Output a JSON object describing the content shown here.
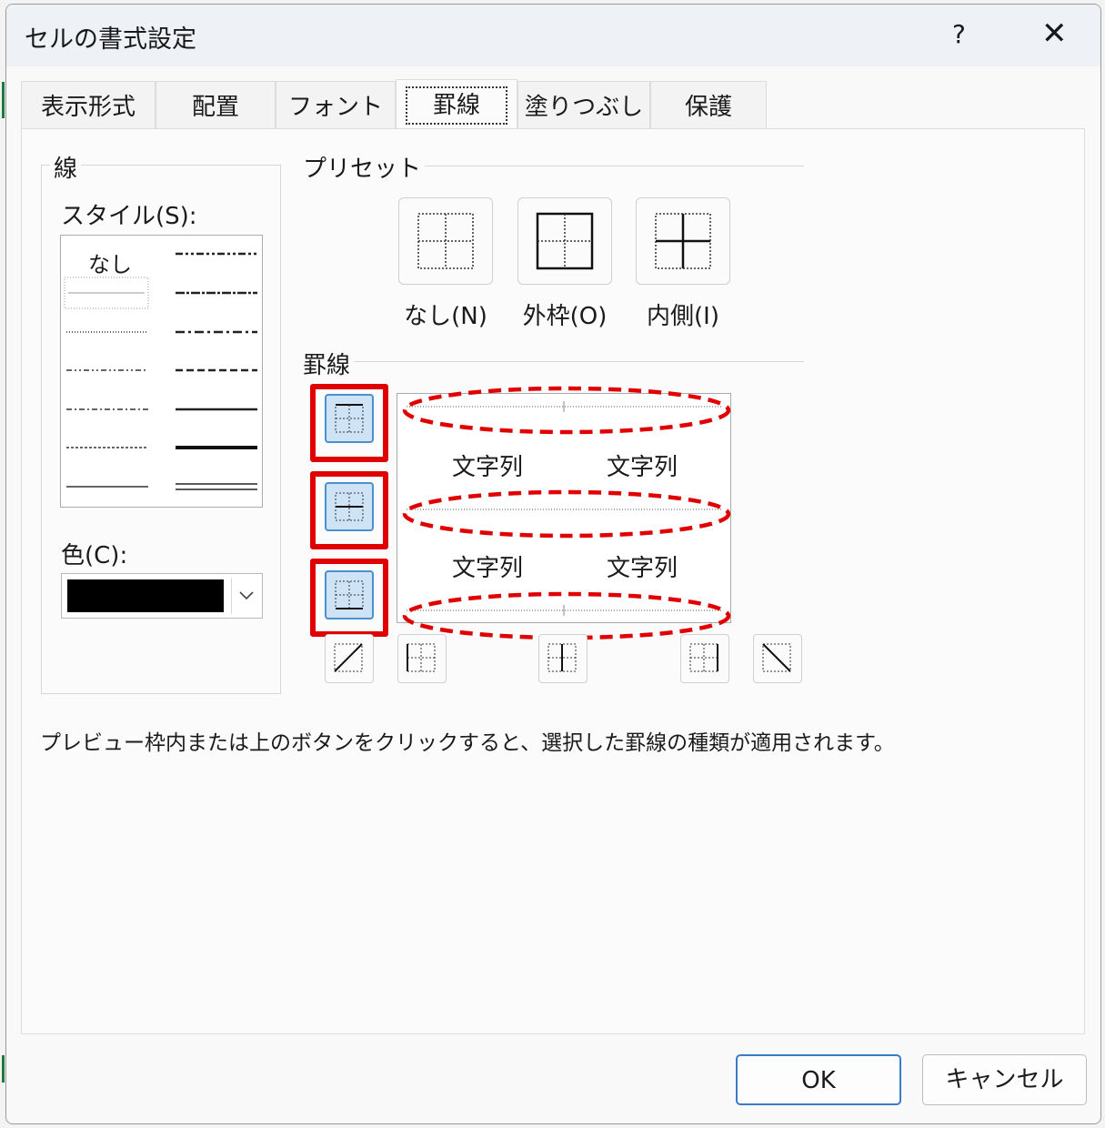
{
  "window": {
    "title": "セルの書式設定",
    "help_label": "?",
    "close_label": "✕"
  },
  "tabs": [
    {
      "label": "表示形式"
    },
    {
      "label": "配置"
    },
    {
      "label": "フォント"
    },
    {
      "label": "罫線",
      "active": true
    },
    {
      "label": "塗りつぶし"
    },
    {
      "label": "保護"
    }
  ],
  "line_group": {
    "label": "線",
    "style_label": "スタイル(S):",
    "style_none": "なし",
    "color_label": "色(C):",
    "color_value": "#000000"
  },
  "presets": {
    "label": "プリセット",
    "items": [
      {
        "label": "なし(N)"
      },
      {
        "label": "外枠(O)"
      },
      {
        "label": "内側(I)"
      }
    ]
  },
  "border_group": {
    "label": "罫線",
    "preview_texts": [
      "文字列",
      "文字列",
      "文字列",
      "文字列"
    ]
  },
  "description": "プレビュー枠内または上のボタンをクリックすると、選択した罫線の種類が適用されます。",
  "buttons": {
    "ok": "OK",
    "cancel": "キャンセル"
  },
  "colors": {
    "accent": "#4a8fce",
    "highlight": "#e00000",
    "selected_bg": "#cfe3f6"
  },
  "icons": [
    "help-icon",
    "close-icon",
    "chevron-down-icon",
    "border-top-icon",
    "border-middle-icon",
    "border-bottom-icon",
    "diagonal-up-icon",
    "border-left-icon",
    "border-center-icon",
    "border-right-icon",
    "diagonal-down-icon"
  ]
}
